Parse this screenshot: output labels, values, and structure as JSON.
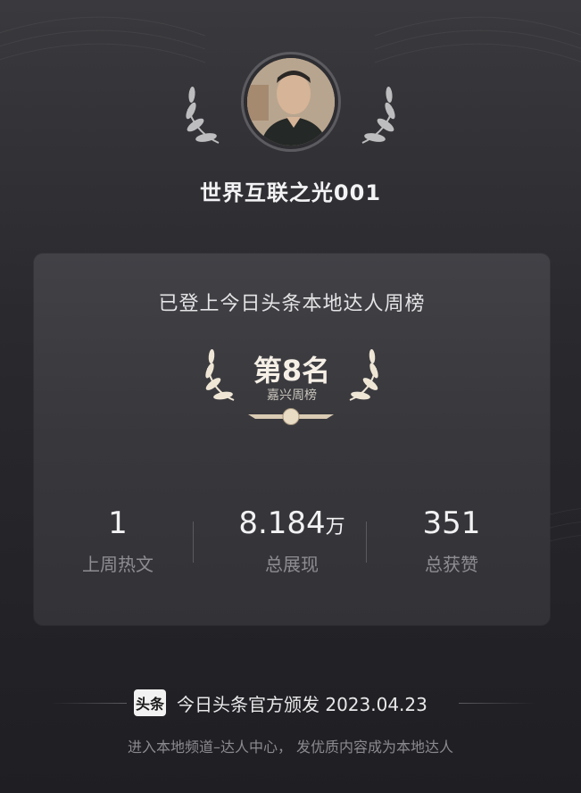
{
  "user": {
    "name": "世界互联之光001"
  },
  "card": {
    "title": "已登上今日头条本地达人周榜",
    "rank": "第8名",
    "rank_sub": "嘉兴周榜",
    "stats": [
      {
        "value": "1",
        "unit": "",
        "label": "上周热文"
      },
      {
        "value": "8.184",
        "unit": "万",
        "label": "总展现"
      },
      {
        "value": "351",
        "unit": "",
        "label": "总获赞"
      }
    ]
  },
  "footer": {
    "logo_text": "头条",
    "issuer": "今日头条官方颁发 2023.04.23",
    "tip": "进入本地频道–达人中心， 发优质内容成为本地达人"
  },
  "colors": {
    "accent": "#f5efe6",
    "muted": "#8d8d92",
    "background": "#2a2a2e"
  },
  "icons": [
    "laurel-left-icon",
    "laurel-right-icon",
    "toutiao-logo-icon"
  ]
}
